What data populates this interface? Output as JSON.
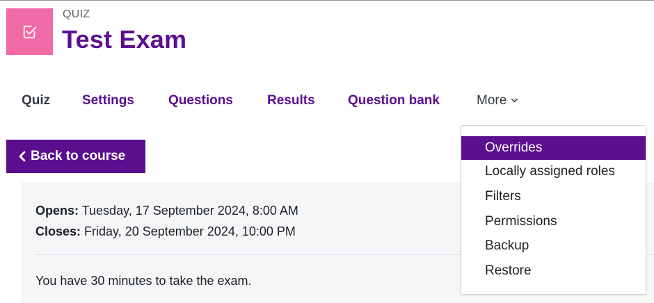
{
  "header": {
    "module_type": "QUIZ",
    "title": "Test Exam",
    "icon_color": "#f06ba6",
    "icon": "checkbox-edit-icon"
  },
  "secondary_nav": {
    "tabs": [
      {
        "label": "Quiz",
        "active": true
      },
      {
        "label": "Settings"
      },
      {
        "label": "Questions"
      },
      {
        "label": "Results"
      },
      {
        "label": "Question bank"
      }
    ],
    "more_label": "More",
    "more_icon": "chevron-down-icon"
  },
  "back_button": {
    "label": "Back to course",
    "icon": "chevron-left-icon"
  },
  "activity_info": {
    "opens_label": "Opens:",
    "opens_value": "Tuesday, 17 September 2024, 8:00 AM",
    "closes_label": "Closes:",
    "closes_value": "Friday, 20 September 2024, 10:00 PM",
    "description": "You have 30 minutes to take the exam."
  },
  "more_menu": {
    "items": [
      {
        "label": "Overrides",
        "active": true
      },
      {
        "label": "Locally assigned roles"
      },
      {
        "label": "Filters"
      },
      {
        "label": "Permissions"
      },
      {
        "label": "Backup"
      },
      {
        "label": "Restore"
      }
    ]
  },
  "colors": {
    "brand_purple": "#5b0f8f",
    "activity_pink": "#f06ba6",
    "info_background": "#f5f6f8"
  }
}
